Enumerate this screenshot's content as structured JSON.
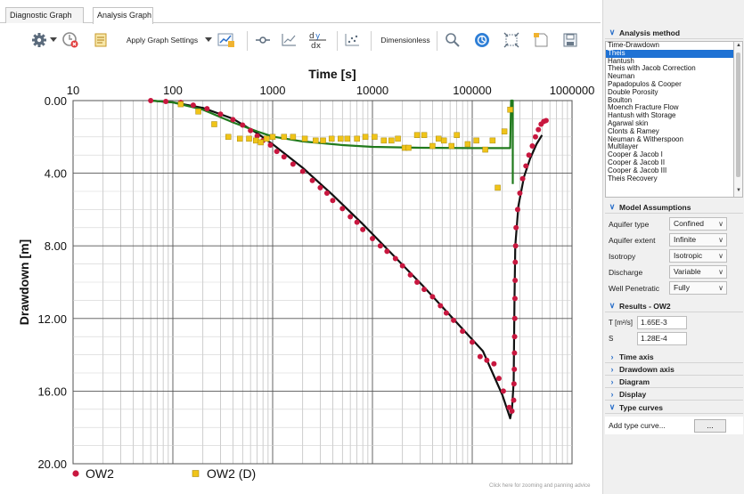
{
  "tabs": [
    {
      "label": "Diagnostic Graph",
      "active": false
    },
    {
      "label": "Analysis Graph",
      "active": true
    }
  ],
  "toolbar": {
    "apply_settings_label": "Apply Graph Settings",
    "dimensionless_label": "Dimensionless",
    "icons": [
      "gear-icon",
      "dropdown-arrow-icon",
      "reset-clock-icon",
      "notes-icon",
      "dropdown-arrow-icon",
      "graph-settings-icon",
      "line-marker-icon",
      "chart-icon",
      "derivative-icon",
      "scatter-icon",
      "zoom-icon",
      "fit-icon",
      "zoom-extent-icon",
      "note-icon",
      "export-icon"
    ]
  },
  "colors": {
    "ow2_marker": "#c8173f",
    "ow2d_marker": "#f0c419",
    "theis_curve": "#111111",
    "derivative_curve": "#207a1c",
    "selected_item": "#1f72d4",
    "panel_chevron": "#2a6fc9"
  },
  "chart_data": {
    "type": "scatter",
    "xlabel": "Time [s]",
    "ylabel": "Drawdown [m]",
    "x_scale": "log",
    "x_ticks": [
      "10",
      "100",
      "1000",
      "10000",
      "100000",
      "1000000"
    ],
    "y_ticks": [
      "0.00",
      "4.00",
      "8.00",
      "12.00",
      "16.00",
      "20.00"
    ],
    "xlim": [
      10,
      1000000
    ],
    "ylim": [
      0,
      20
    ],
    "y_inverted": true,
    "grid": true,
    "legend_position": "bottom",
    "legend": [
      "OW2",
      "OW2 (D)"
    ],
    "series": [
      {
        "name": "OW2",
        "marker": "circle",
        "points": [
          [
            60,
            0
          ],
          [
            85,
            0.05
          ],
          [
            120,
            0.1
          ],
          [
            160,
            0.25
          ],
          [
            220,
            0.45
          ],
          [
            300,
            0.75
          ],
          [
            400,
            1.05
          ],
          [
            500,
            1.35
          ],
          [
            600,
            1.65
          ],
          [
            700,
            1.95
          ],
          [
            800,
            2.2
          ],
          [
            950,
            2.45
          ],
          [
            1100,
            2.8
          ],
          [
            1300,
            3.1
          ],
          [
            1600,
            3.5
          ],
          [
            2000,
            3.9
          ],
          [
            2500,
            4.4
          ],
          [
            3000,
            4.8
          ],
          [
            3500,
            5.1
          ],
          [
            4000,
            5.5
          ],
          [
            5000,
            5.95
          ],
          [
            6000,
            6.4
          ],
          [
            7000,
            6.7
          ],
          [
            8000,
            7.1
          ],
          [
            10000,
            7.6
          ],
          [
            12000,
            8.0
          ],
          [
            14000,
            8.3
          ],
          [
            17000,
            8.7
          ],
          [
            20000,
            9.1
          ],
          [
            24000,
            9.6
          ],
          [
            28000,
            10.0
          ],
          [
            33000,
            10.4
          ],
          [
            40000,
            10.8
          ],
          [
            48000,
            11.3
          ],
          [
            55000,
            11.7
          ],
          [
            65000,
            12.1
          ],
          [
            80000,
            12.7
          ],
          [
            100000,
            13.3
          ],
          [
            120000,
            14.1
          ],
          [
            140000,
            14.3
          ],
          [
            165000,
            14.5
          ],
          [
            185000,
            15.3
          ],
          [
            205000,
            16.0
          ],
          [
            235000,
            16.9
          ],
          [
            250000,
            17.1
          ],
          [
            260000,
            16.5
          ],
          [
            262000,
            15.6
          ],
          [
            264000,
            14.8
          ],
          [
            265000,
            13.9
          ],
          [
            266000,
            13.0
          ],
          [
            267000,
            12.0
          ],
          [
            268000,
            10.9
          ],
          [
            269000,
            9.9
          ],
          [
            270000,
            8.9
          ],
          [
            272000,
            8.0
          ],
          [
            275000,
            7.0
          ],
          [
            285000,
            6.0
          ],
          [
            300000,
            5.1
          ],
          [
            320000,
            4.3
          ],
          [
            345000,
            3.6
          ],
          [
            370000,
            3.0
          ],
          [
            400000,
            2.5
          ],
          [
            430000,
            2.0
          ],
          [
            460000,
            1.6
          ],
          [
            490000,
            1.3
          ],
          [
            520000,
            1.15
          ],
          [
            550000,
            1.1
          ]
        ]
      },
      {
        "name": "OW2 (D)",
        "marker": "square",
        "points": [
          [
            120,
            0.2
          ],
          [
            180,
            0.6
          ],
          [
            260,
            1.3
          ],
          [
            360,
            2.0
          ],
          [
            470,
            2.1
          ],
          [
            580,
            2.1
          ],
          [
            680,
            2.2
          ],
          [
            760,
            2.3
          ],
          [
            870,
            2.1
          ],
          [
            1000,
            2.0
          ],
          [
            1300,
            2.0
          ],
          [
            1600,
            2.0
          ],
          [
            2100,
            2.1
          ],
          [
            2700,
            2.2
          ],
          [
            3200,
            2.2
          ],
          [
            3900,
            2.1
          ],
          [
            4800,
            2.1
          ],
          [
            5600,
            2.1
          ],
          [
            7000,
            2.1
          ],
          [
            8500,
            2.0
          ],
          [
            10500,
            2.0
          ],
          [
            13000,
            2.2
          ],
          [
            15500,
            2.2
          ],
          [
            18000,
            2.1
          ],
          [
            21000,
            2.6
          ],
          [
            23000,
            2.6
          ],
          [
            28000,
            1.9
          ],
          [
            33000,
            1.9
          ],
          [
            40000,
            2.5
          ],
          [
            46000,
            2.1
          ],
          [
            52000,
            2.2
          ],
          [
            62000,
            2.5
          ],
          [
            70000,
            1.9
          ],
          [
            90000,
            2.4
          ],
          [
            110000,
            2.2
          ],
          [
            135000,
            2.7
          ],
          [
            160000,
            2.2
          ],
          [
            180000,
            4.8
          ],
          [
            210000,
            1.7
          ],
          [
            240000,
            0.5
          ]
        ]
      }
    ],
    "fitted_curves": [
      {
        "name": "Theis type curve",
        "points": [
          [
            60,
            0
          ],
          [
            100,
            0.1
          ],
          [
            200,
            0.4
          ],
          [
            400,
            1.0
          ],
          [
            700,
            1.8
          ],
          [
            1000,
            2.4
          ],
          [
            2000,
            3.7
          ],
          [
            4000,
            5.2
          ],
          [
            8000,
            6.8
          ],
          [
            16000,
            8.5
          ],
          [
            32000,
            10.2
          ],
          [
            64000,
            12.0
          ],
          [
            128000,
            13.8
          ],
          [
            200000,
            16.2
          ],
          [
            240000,
            17.5
          ],
          [
            250000,
            17.0
          ],
          [
            260000,
            15.5
          ],
          [
            265000,
            11.0
          ],
          [
            270000,
            8.0
          ],
          [
            290000,
            5.8
          ],
          [
            330000,
            4.2
          ],
          [
            380000,
            3.2
          ],
          [
            440000,
            2.4
          ],
          [
            500000,
            1.9
          ]
        ]
      },
      {
        "name": "Derivative type curve",
        "points": [
          [
            60,
            0
          ],
          [
            100,
            0.1
          ],
          [
            200,
            0.5
          ],
          [
            400,
            1.2
          ],
          [
            700,
            1.7
          ],
          [
            1000,
            1.98
          ],
          [
            2000,
            2.25
          ],
          [
            5000,
            2.45
          ],
          [
            10000,
            2.55
          ],
          [
            30000,
            2.6
          ],
          [
            100000,
            2.62
          ],
          [
            240000,
            2.62
          ],
          [
            245000,
            0
          ],
          [
            255000,
            0
          ],
          [
            255000,
            4.6
          ]
        ]
      }
    ],
    "hint": "Click here for zooming and panning advice"
  },
  "panel": {
    "analysis_method": {
      "title": "Analysis method",
      "items": [
        "Time-Drawdown",
        "Theis",
        "Hantush",
        "Theis with Jacob Correction",
        "Neuman",
        "Papadopulos & Cooper",
        "Double Porosity",
        "Boulton",
        "Moench Fracture Flow",
        "Hantush with Storage",
        "Agarwal skin",
        "Clonts & Ramey",
        "Neuman & Witherspoon",
        "Multilayer",
        "Cooper & Jacob I",
        "Cooper & Jacob II",
        "Cooper & Jacob III",
        "Theis Recovery"
      ],
      "selected": "Theis"
    },
    "model_assumptions": {
      "title": "Model Assumptions",
      "rows": [
        {
          "label": "Aquifer type",
          "value": "Confined"
        },
        {
          "label": "Aquifer extent",
          "value": "Infinite"
        },
        {
          "label": "Isotropy",
          "value": "Isotropic"
        },
        {
          "label": "Discharge",
          "value": "Variable"
        },
        {
          "label": "Well Penetratic",
          "value": "Fully"
        }
      ]
    },
    "results": {
      "title": "Results - OW2",
      "rows": [
        {
          "label": "T [m²/s]",
          "value": "1.65E-3"
        },
        {
          "label": "S",
          "value": "1.28E-4"
        }
      ]
    },
    "collapsed_sections": [
      "Time axis",
      "Drawdown axis",
      "Diagram",
      "Display"
    ],
    "type_curves": {
      "title": "Type curves",
      "add_label": "Add type curve...",
      "button_label": "..."
    }
  }
}
